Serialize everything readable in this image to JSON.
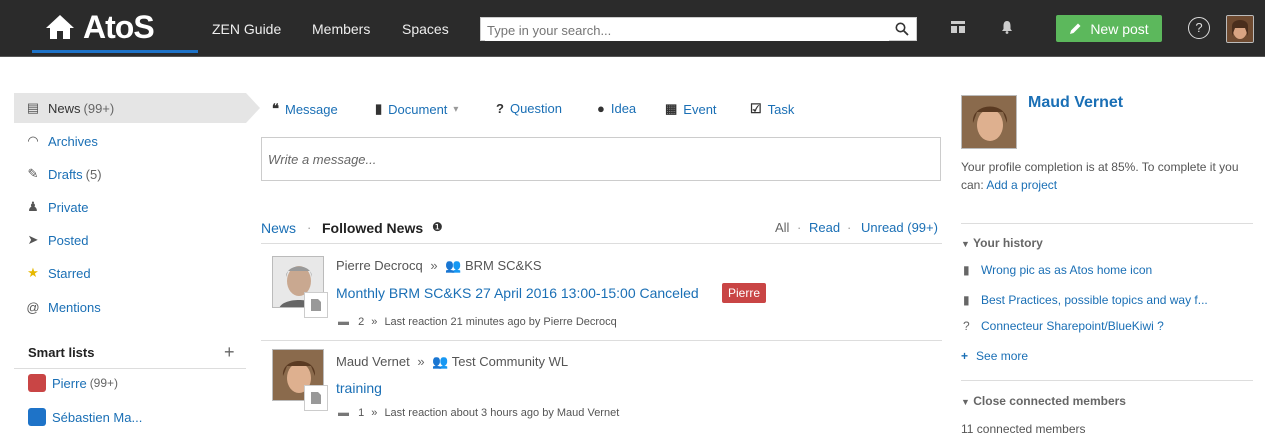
{
  "topbar": {
    "brand": "AtoS",
    "nav": [
      "ZEN Guide",
      "Members",
      "Spaces"
    ],
    "search_placeholder": "Type in your search...",
    "new_post": "New post",
    "help": "?"
  },
  "sidebar": {
    "items": [
      {
        "label": "News",
        "count": "(99+)",
        "icon": "news-icon"
      },
      {
        "label": "Archives",
        "count": "",
        "icon": "archive-icon"
      },
      {
        "label": "Drafts",
        "count": "(5)",
        "icon": "pencil-icon"
      },
      {
        "label": "Private",
        "count": "",
        "icon": "user-icon"
      },
      {
        "label": "Posted",
        "count": "",
        "icon": "send-icon"
      },
      {
        "label": "Starred",
        "count": "",
        "icon": "star-icon"
      },
      {
        "label": "Mentions",
        "count": "",
        "icon": "at-icon"
      }
    ],
    "smart_lists_title": "Smart lists",
    "smart_lists": [
      {
        "label": "Pierre",
        "count": "(99+)",
        "color": "#c94545"
      },
      {
        "label": "Sébastien Ma...",
        "count": "",
        "color": "#1e73c8"
      }
    ]
  },
  "composer": {
    "types": [
      "Message",
      "Document",
      "Question",
      "Idea",
      "Event",
      "Task"
    ],
    "placeholder": "Write a message..."
  },
  "feed": {
    "tab_news": "News",
    "tab_followed": "Followed News",
    "filter_all": "All",
    "filter_read": "Read",
    "filter_unread": "Unread (99+)",
    "posts": [
      {
        "author": "Pierre Decrocq",
        "community": "BRM SC&KS",
        "title": "Monthly BRM SC&KS 27 April 2016 13:00-15:00 Canceled",
        "tag": "Pierre",
        "comments": "2",
        "reaction": "Last reaction 21 minutes ago by Pierre Decrocq"
      },
      {
        "author": "Maud Vernet",
        "community": "Test Community WL",
        "title": "training",
        "tag": "",
        "comments": "1",
        "reaction": "Last reaction about 3 hours ago by Maud Vernet"
      }
    ]
  },
  "profile": {
    "name": "Maud Vernet",
    "completion_text": "Your profile completion is at 85%. To complete it you can:",
    "completion_link": "Add a project",
    "history_title": "Your history",
    "history": [
      {
        "label": "Wrong pic as as Atos home icon",
        "icon": "document-icon"
      },
      {
        "label": "Best Practices, possible topics and way f...",
        "icon": "document-icon"
      },
      {
        "label": "Connecteur Sharepoint/BlueKiwi ?",
        "icon": "question-icon"
      }
    ],
    "see_more": "See more",
    "connected_title": "Close connected members",
    "connected_count": "11 connected members"
  }
}
